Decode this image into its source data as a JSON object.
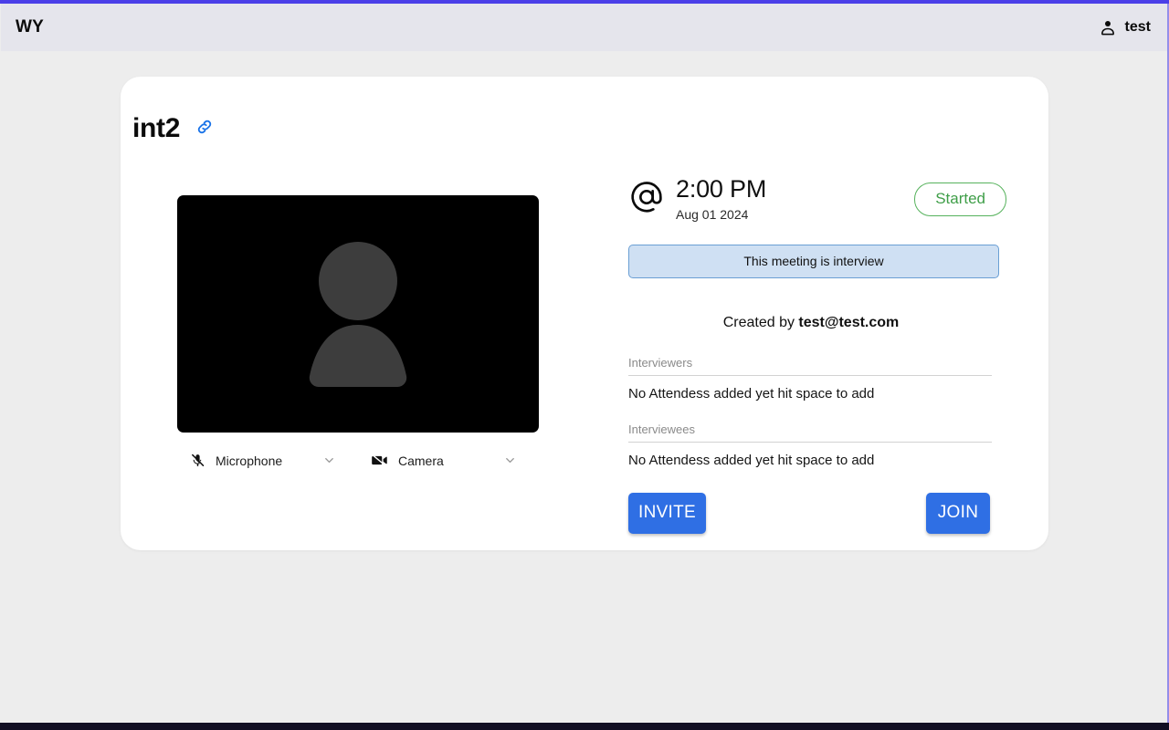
{
  "theme": {
    "accent_bar": "#4b3fe8",
    "primary_button": "#2f6fe4",
    "status_green": "#3f9e48",
    "note_bg": "#cfe0f3",
    "note_border": "#6a9fd4",
    "page_bg": "#ededed",
    "header_bg": "#e5e5ec",
    "card_bg": "#ffffff",
    "video_bg": "#000000"
  },
  "header": {
    "brand": "WY",
    "user_icon": "person-icon",
    "user_name": "test"
  },
  "meeting": {
    "title": "int2",
    "copy_link_icon": "link-icon",
    "at_icon": "at-icon",
    "time": "2:00 PM",
    "date": "Aug 01 2024",
    "status": "Started",
    "note": "This meeting is interview",
    "created_by_prefix": "Created by",
    "created_by_email": "test@test.com"
  },
  "preview": {
    "avatar_icon": "person-avatar-icon",
    "microphone": {
      "icon": "microphone-off-icon",
      "label": "Microphone",
      "chevron": "chevron-down-icon"
    },
    "camera": {
      "icon": "video-camera-off-icon",
      "label": "Camera",
      "chevron": "chevron-down-icon"
    }
  },
  "attendees": {
    "interviewers": {
      "label": "Interviewers",
      "value": "No Attendess added yet hit space to add"
    },
    "interviewees": {
      "label": "Interviewees",
      "value": "No Attendess added yet hit space to add"
    }
  },
  "actions": {
    "invite": "INVITE",
    "join": "JOIN"
  }
}
